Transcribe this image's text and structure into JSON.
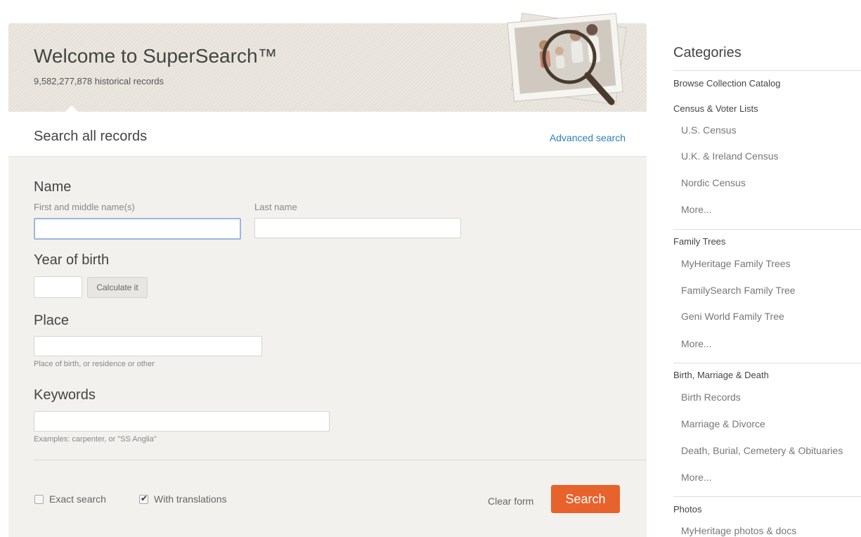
{
  "header": {
    "title": "Welcome to SuperSearch™",
    "records_count": "9,582,277,878 historical records"
  },
  "search_bar": {
    "title": "Search all records",
    "advanced_link": "Advanced search"
  },
  "form": {
    "name_section": "Name",
    "first_name_label": "First and middle name(s)",
    "last_name_label": "Last name",
    "first_name_value": "",
    "last_name_value": "",
    "year_section": "Year of birth",
    "year_value": "",
    "calculate_label": "Calculate it",
    "place_section": "Place",
    "place_value": "",
    "place_hint": "Place of birth, or residence or other",
    "keywords_section": "Keywords",
    "keywords_value": "",
    "keywords_hint": "Examples: carpenter, or \"SS Anglia\"",
    "exact_search_label": "Exact search",
    "exact_search_checked": false,
    "translations_label": "With translations",
    "translations_checked": true,
    "clear_label": "Clear form",
    "search_label": "Search"
  },
  "colors": {
    "accent_orange": "#e8622b",
    "link_blue": "#2a82b5",
    "panel_bg": "#f3f1ee"
  },
  "sidebar": {
    "title": "Categories",
    "browse_catalog": "Browse Collection Catalog",
    "groups": [
      {
        "name": "Census & Voter Lists",
        "items": [
          "U.S. Census",
          "U.K. & Ireland Census",
          "Nordic Census",
          "More..."
        ]
      },
      {
        "name": "Family Trees",
        "items": [
          "MyHeritage Family Trees",
          "FamilySearch Family Tree",
          "Geni World Family Tree",
          "More..."
        ]
      },
      {
        "name": "Birth, Marriage & Death",
        "items": [
          "Birth Records",
          "Marriage & Divorce",
          "Death, Burial, Cemetery & Obituaries",
          "More..."
        ]
      },
      {
        "name": "Photos",
        "items": [
          "MyHeritage photos & docs"
        ]
      }
    ]
  }
}
